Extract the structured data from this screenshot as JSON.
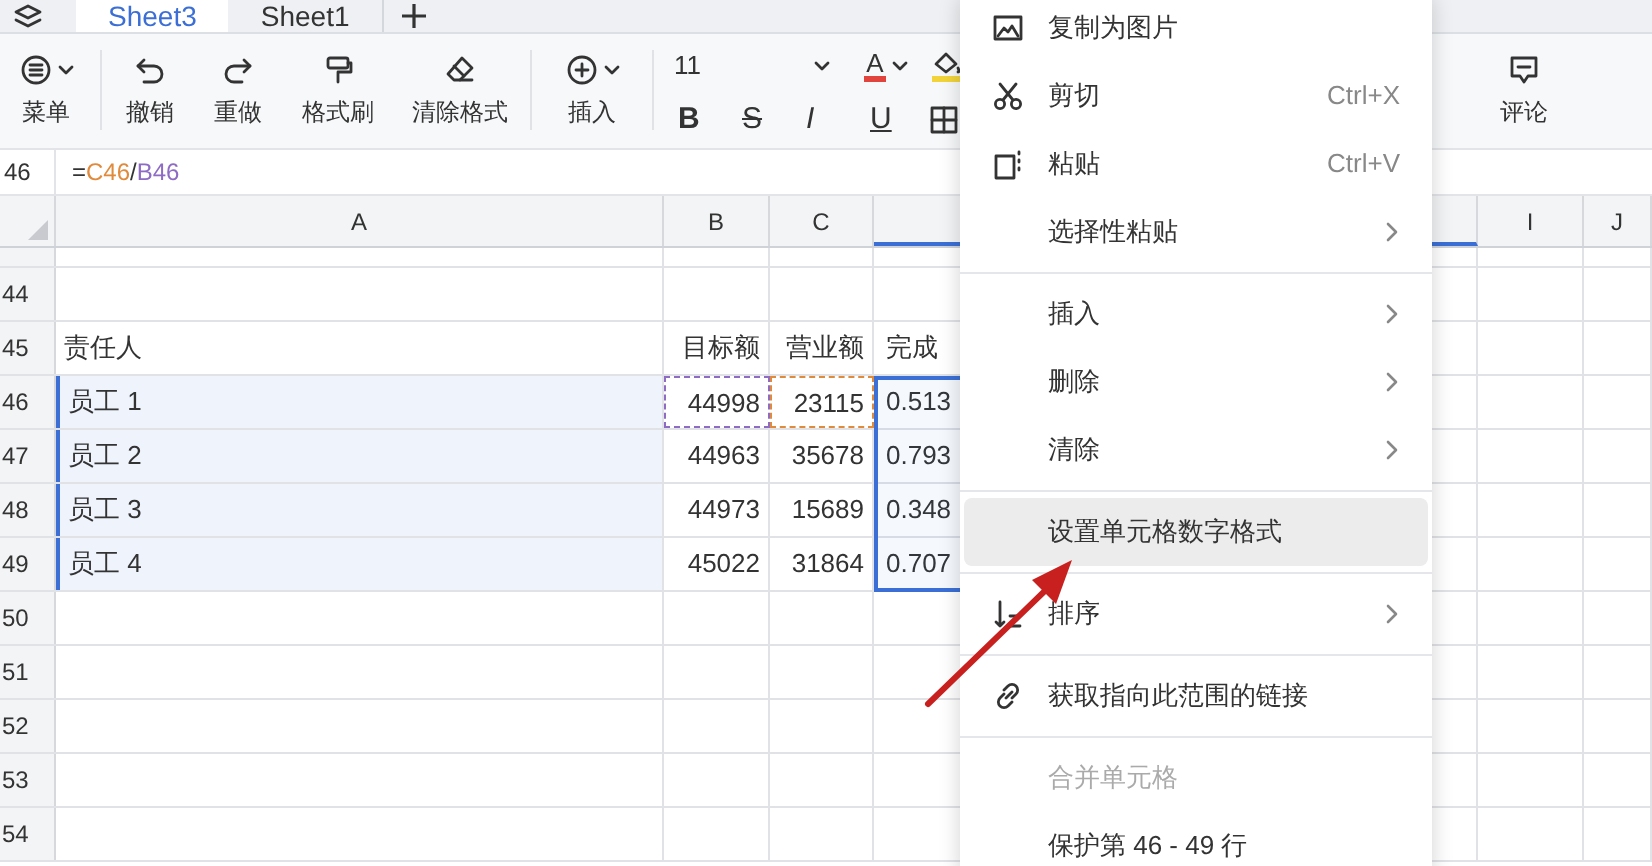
{
  "sheet_tabs": [
    {
      "label": "Sheet3",
      "selected": true
    },
    {
      "label": "Sheet1",
      "selected": false
    }
  ],
  "toolbar": {
    "buttons": [
      {
        "kind": "menu",
        "label": "菜单",
        "caret": true
      },
      {
        "kind": "undo",
        "label": "撤销",
        "caret": false
      },
      {
        "kind": "redo",
        "label": "重做",
        "caret": false
      },
      {
        "kind": "format_painter",
        "label": "格式刷",
        "caret": false
      },
      {
        "kind": "clear_format",
        "label": "清除格式",
        "caret": false
      },
      {
        "kind": "insert",
        "label": "插入",
        "caret": true
      }
    ],
    "font_size": "11",
    "text_color": {
      "label": "A",
      "color": "#e0443c"
    },
    "fill_color": {
      "color": "#f2d43a"
    },
    "styles": [
      {
        "kind": "bold",
        "label": "B"
      },
      {
        "kind": "strike",
        "label": "S"
      },
      {
        "kind": "italic",
        "label": "I"
      },
      {
        "kind": "underline",
        "label": "U"
      }
    ],
    "comment": {
      "label": "评论"
    }
  },
  "formula_bar": {
    "cell_ref": "46",
    "tokens": [
      {
        "text": "=",
        "color": "#333333"
      },
      {
        "text": "C46",
        "color": "#e08a3c"
      },
      {
        "text": "/",
        "color": "#333333"
      },
      {
        "text": "B46",
        "color": "#8e6cc4"
      }
    ]
  },
  "columns": [
    {
      "label": "A",
      "selected": false
    },
    {
      "label": "B",
      "selected": false
    },
    {
      "label": "C",
      "selected": false
    },
    {
      "selected": true
    },
    {
      "label": "I",
      "selected": false
    },
    {
      "label": "J",
      "selected": false
    }
  ],
  "rows": [
    {
      "number": "44",
      "selected": false,
      "cells": []
    },
    {
      "number": "45",
      "selected": false,
      "cells": [
        {
          "text": "责任人"
        },
        {
          "text": "目标额"
        },
        {
          "text": "营业额"
        },
        {
          "text": "完成"
        }
      ]
    },
    {
      "number": "46",
      "selected": true,
      "cells": [
        {
          "text": "员工 1"
        },
        {
          "text": "44998",
          "color": "#8e6cc4"
        },
        {
          "text": "23115",
          "color": "#e08a3c"
        },
        {
          "text": "0.513"
        }
      ]
    },
    {
      "number": "47",
      "selected": true,
      "cells": [
        {
          "text": "员工 2"
        },
        {
          "text": "44963"
        },
        {
          "text": "35678"
        },
        {
          "text": "0.793"
        }
      ]
    },
    {
      "number": "48",
      "selected": true,
      "cells": [
        {
          "text": "员工 3"
        },
        {
          "text": "44973"
        },
        {
          "text": "15689"
        },
        {
          "text": "0.348"
        }
      ]
    },
    {
      "number": "49",
      "selected": true,
      "cells": [
        {
          "text": "员工 4"
        },
        {
          "text": "45022"
        },
        {
          "text": "31864"
        },
        {
          "text": "0.707"
        }
      ]
    },
    {
      "number": "50",
      "selected": false,
      "cells": []
    },
    {
      "number": "51",
      "selected": false,
      "cells": []
    },
    {
      "number": "52",
      "selected": false,
      "cells": []
    },
    {
      "number": "53",
      "selected": false,
      "cells": []
    },
    {
      "number": "54",
      "selected": false,
      "cells": []
    }
  ],
  "context_menu": [
    {
      "kind": "copy_image",
      "label": "复制为图片",
      "selected": false,
      "disabled": false,
      "submenu": false
    },
    {
      "kind": "cut",
      "label": "剪切",
      "shortcut": "Ctrl+X",
      "selected": false,
      "disabled": false,
      "submenu": false
    },
    {
      "kind": "paste",
      "label": "粘贴",
      "shortcut": "Ctrl+V",
      "selected": false,
      "disabled": false,
      "submenu": false
    },
    {
      "kind": "item",
      "label": "选择性粘贴",
      "selected": false,
      "disabled": false,
      "submenu": true
    },
    {
      "kind": "separator"
    },
    {
      "kind": "item",
      "label": "插入",
      "selected": false,
      "disabled": false,
      "submenu": true
    },
    {
      "kind": "item",
      "label": "删除",
      "selected": false,
      "disabled": false,
      "submenu": true
    },
    {
      "kind": "item",
      "label": "清除",
      "selected": false,
      "disabled": false,
      "submenu": true
    },
    {
      "kind": "separator"
    },
    {
      "kind": "item",
      "label": "设置单元格数字格式",
      "selected": true,
      "disabled": false,
      "submenu": false
    },
    {
      "kind": "separator"
    },
    {
      "kind": "sort",
      "label": "排序",
      "selected": false,
      "disabled": false,
      "submenu": true
    },
    {
      "kind": "separator"
    },
    {
      "kind": "link",
      "label": "获取指向此范围的链接",
      "selected": false,
      "disabled": false,
      "submenu": false
    },
    {
      "kind": "separator"
    },
    {
      "kind": "item",
      "label": "合并单元格",
      "selected": false,
      "disabled": true,
      "submenu": false
    },
    {
      "kind": "item",
      "label": "保护第 46 - 49 行",
      "selected": false,
      "disabled": false,
      "submenu": false
    }
  ]
}
